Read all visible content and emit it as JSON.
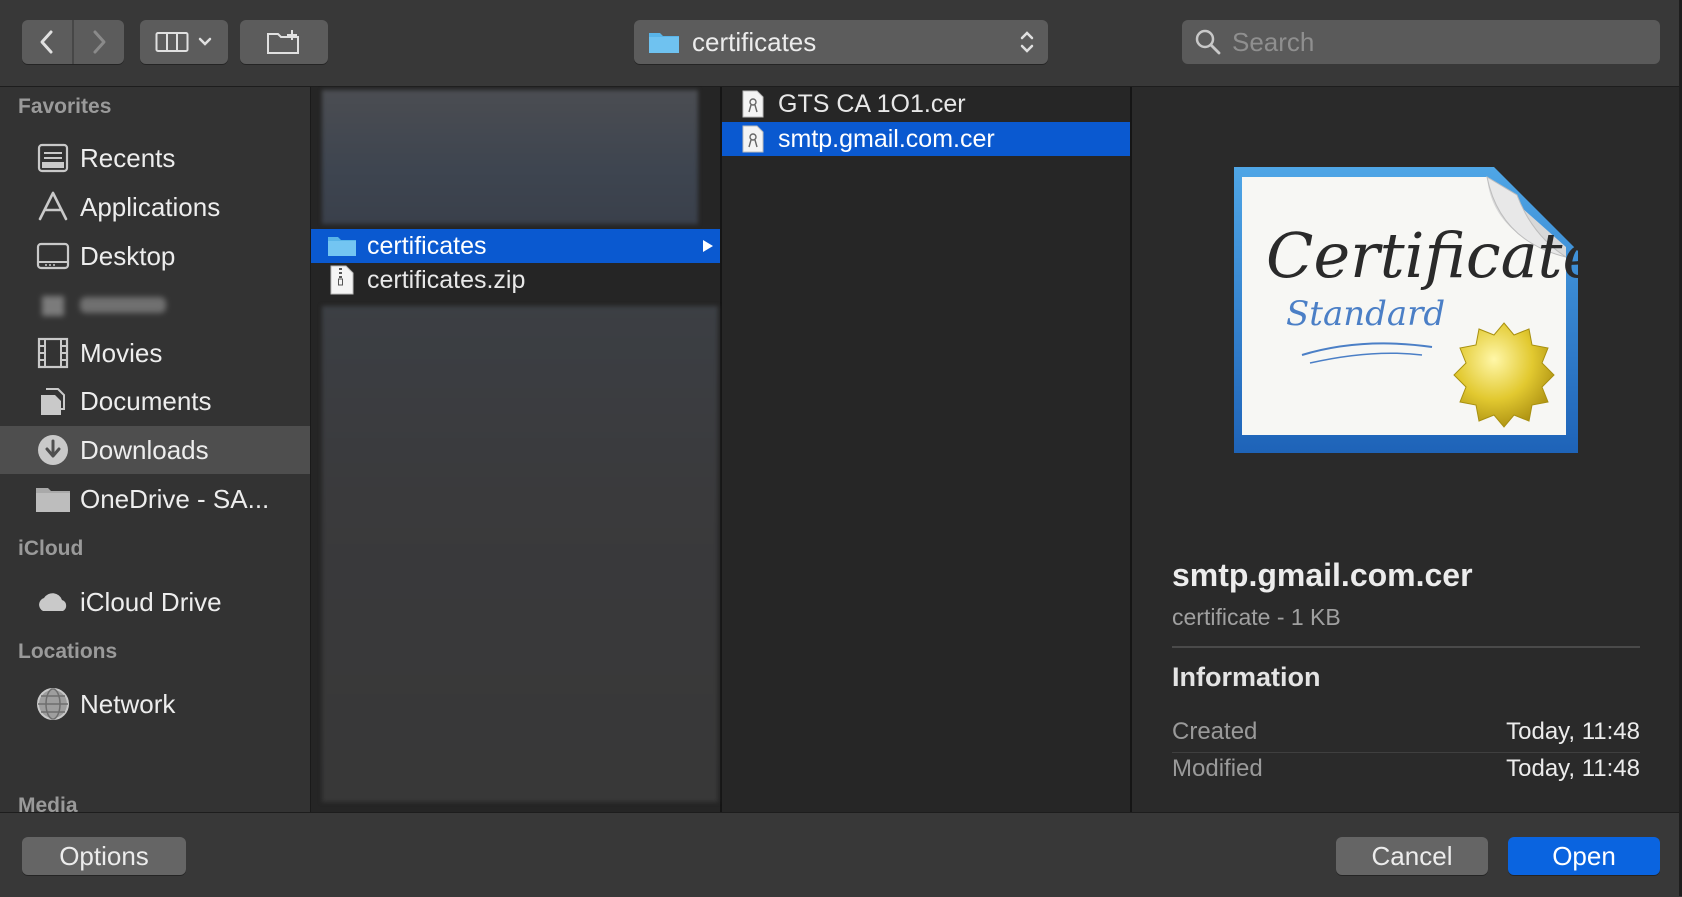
{
  "toolbar": {
    "back_icon": "chevron-left-icon",
    "forward_icon": "chevron-right-icon",
    "view_icon": "column-view-icon",
    "new_folder_icon": "new-folder-icon",
    "path": {
      "label": "certificates",
      "icon": "folder-icon"
    },
    "search": {
      "placeholder": "Search"
    }
  },
  "sidebar": {
    "favorites_header": "Favorites",
    "favorites": [
      {
        "label": "Recents",
        "icon": "recents-icon"
      },
      {
        "label": "Applications",
        "icon": "applications-icon"
      },
      {
        "label": "Desktop",
        "icon": "desktop-icon"
      },
      {
        "label": "",
        "icon": "home-icon",
        "blurred": true
      },
      {
        "label": "Movies",
        "icon": "movies-icon"
      },
      {
        "label": "Documents",
        "icon": "documents-icon"
      },
      {
        "label": "Downloads",
        "icon": "downloads-icon",
        "selected": true
      },
      {
        "label": "OneDrive - SA...",
        "icon": "folder-icon"
      }
    ],
    "icloud_header": "iCloud",
    "icloud": [
      {
        "label": "iCloud Drive",
        "icon": "cloud-icon"
      }
    ],
    "locations_header": "Locations",
    "locations": [
      {
        "label": "Network",
        "icon": "network-icon"
      }
    ],
    "media_header": "Media"
  },
  "column1": {
    "items": [
      {
        "label": "certificates",
        "icon": "folder-icon",
        "selected": true
      },
      {
        "label": "certificates.zip",
        "icon": "zip-file-icon"
      }
    ]
  },
  "column2": {
    "items": [
      {
        "label": "GTS CA 1O1.cer",
        "icon": "certificate-file-icon"
      },
      {
        "label": "smtp.gmail.com.cer",
        "icon": "certificate-file-icon",
        "selected": true
      }
    ]
  },
  "preview": {
    "image_icon": "certificate-standard-icon",
    "image_text_main": "Certificate",
    "image_text_sub": "Standard",
    "name": "smtp.gmail.com.cer",
    "kind": "certificate - 1 KB",
    "info_header": "Information",
    "info": [
      {
        "key": "Created",
        "value": "Today, 11:48"
      },
      {
        "key": "Modified",
        "value": "Today, 11:48"
      }
    ]
  },
  "buttons": {
    "options": "Options",
    "cancel": "Cancel",
    "open": "Open"
  },
  "colors": {
    "selection": "#0a59d0",
    "accent": "#0a64e0",
    "folder": "#59b4e8"
  }
}
